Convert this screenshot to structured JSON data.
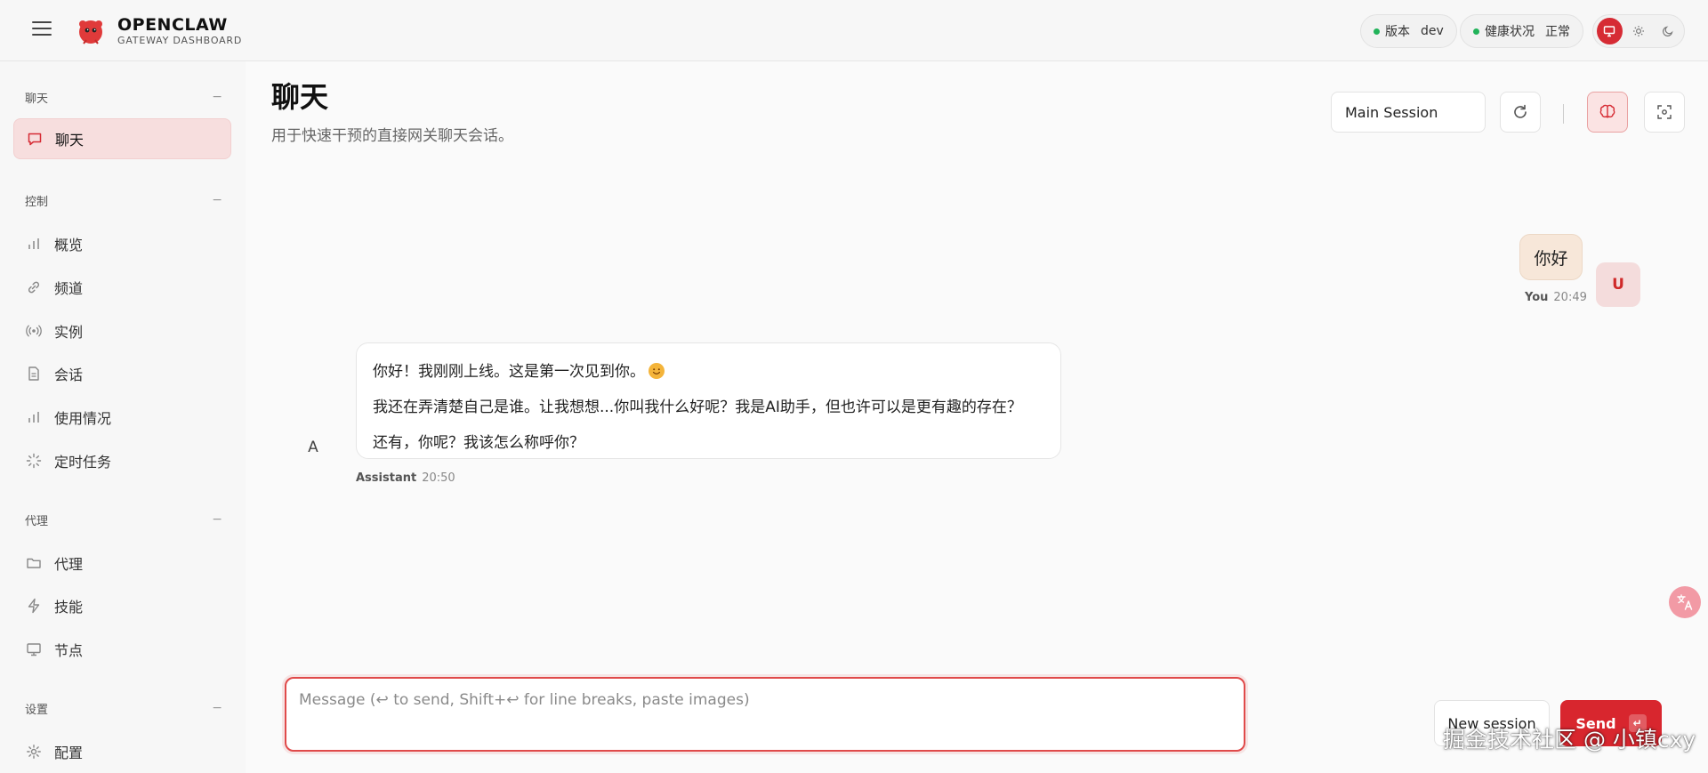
{
  "header": {
    "brand_name": "OPENCLAW",
    "brand_sub": "GATEWAY DASHBOARD",
    "version_label": "版本",
    "version_value": "dev",
    "health_label": "健康状况",
    "health_value": "正常",
    "status_color": "#22b35a",
    "accent_color": "#d8262e"
  },
  "sidebar": {
    "sections": [
      {
        "title": "聊天",
        "items": [
          {
            "label": "聊天",
            "icon": "message-icon",
            "active": true
          }
        ]
      },
      {
        "title": "控制",
        "items": [
          {
            "label": "概览",
            "icon": "bar-chart-icon"
          },
          {
            "label": "频道",
            "icon": "link-icon"
          },
          {
            "label": "实例",
            "icon": "radio-icon"
          },
          {
            "label": "会话",
            "icon": "document-icon"
          },
          {
            "label": "使用情况",
            "icon": "bar-chart-icon"
          },
          {
            "label": "定时任务",
            "icon": "loader-icon"
          }
        ]
      },
      {
        "title": "代理",
        "items": [
          {
            "label": "代理",
            "icon": "folder-icon"
          },
          {
            "label": "技能",
            "icon": "zap-icon"
          },
          {
            "label": "节点",
            "icon": "monitor-icon"
          }
        ]
      },
      {
        "title": "设置",
        "items": [
          {
            "label": "配置",
            "icon": "gear-icon"
          }
        ]
      }
    ]
  },
  "main": {
    "title": "聊天",
    "subtitle": "用于快速干预的直接网关聊天会话。",
    "session": "Main Session"
  },
  "messages": {
    "user": {
      "text": "你好",
      "author": "You",
      "time": "20:49",
      "avatar": "U"
    },
    "assistant": {
      "lines": [
        "你好！我刚刚上线。这是第一次见到你。",
        "我还在弄清楚自己是谁。让我想想...你叫我什么好呢？我是AI助手，但也许可以是更有趣的存在？",
        "还有，你呢？我该怎么称呼你？"
      ],
      "author": "Assistant",
      "time": "20:50",
      "avatar": "A"
    }
  },
  "composer": {
    "placeholder": "Message (↩ to send, Shift+↩ for line breaks, paste images)",
    "new_session": "New session",
    "send": "Send",
    "send_key": "↵"
  },
  "watermark": "掘金技术社区 @ 小镇cxy"
}
